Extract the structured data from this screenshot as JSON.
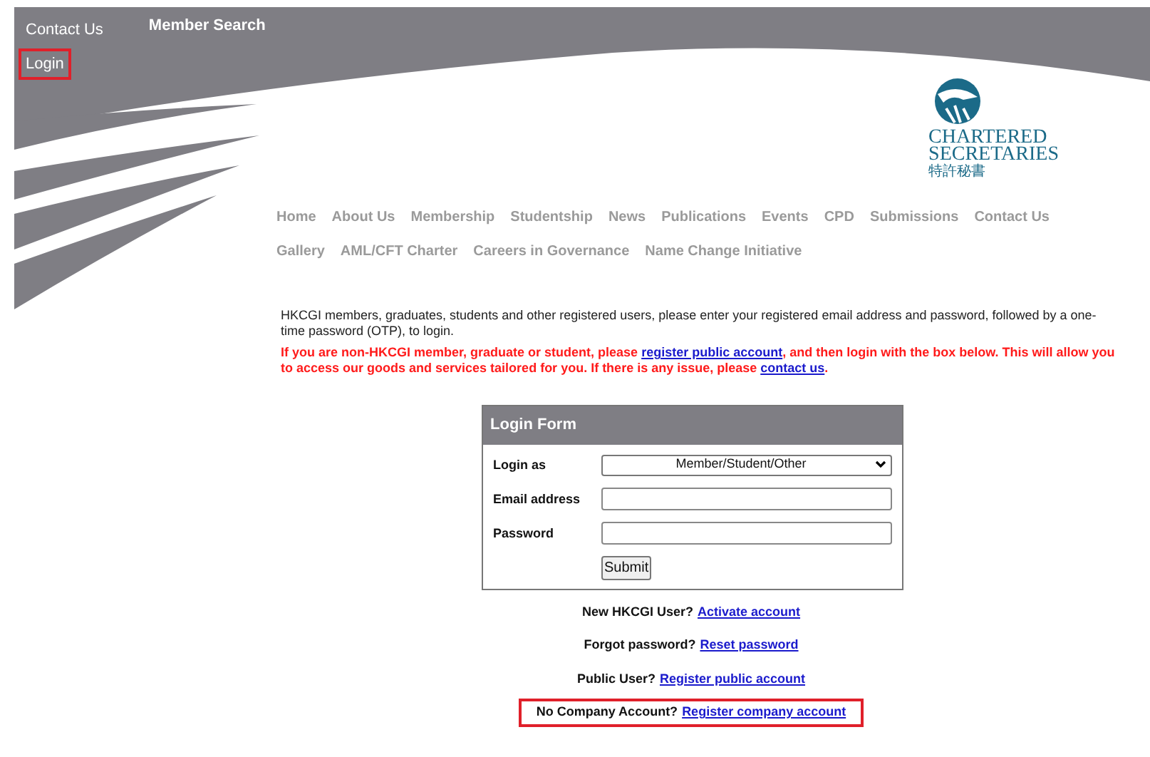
{
  "top_links": [
    {
      "label": "Contact Us",
      "bold": false,
      "highlighted": false
    },
    {
      "label": "Member Search",
      "bold": true,
      "highlighted": false
    },
    {
      "label": "Login",
      "bold": false,
      "highlighted": true
    }
  ],
  "logo": {
    "line_1": "CHARTERED",
    "line_2": "SECRETARIES",
    "line_3": "特許秘書"
  },
  "nav": [
    [
      "Home",
      "About Us",
      "Membership",
      "Studentship",
      "News",
      "Publications",
      "Events",
      "CPD",
      "Submissions",
      "Contact Us"
    ],
    [
      "Gallery",
      "AML/CFT Charter",
      "Careers in Governance",
      "Name Change Initiative"
    ]
  ],
  "intro": "HKCGI members, graduates, students and other registered users, please enter your registered email address and password, followed by a one-time password (OTP), to login.",
  "notice": {
    "before": "If you are non-HKCGI member, graduate or student, please ",
    "link_1": "register public account",
    "middle": ", and then login with the box below. This will allow you to access our goods and services tailored for you. If there is any issue, please ",
    "link_2": "contact us",
    "after": "."
  },
  "login_form": {
    "title": "Login Form",
    "fields": [
      {
        "kind": "select",
        "label": "Login as",
        "value": "Member/Student/Other"
      },
      {
        "kind": "text",
        "label": "Email address"
      },
      {
        "kind": "password",
        "label": "Password"
      }
    ],
    "submit": "Submit"
  },
  "help_links": [
    {
      "prompt": "New HKCGI User?",
      "link": "Activate account",
      "highlighted": false
    },
    {
      "prompt": "Forgot password?",
      "link": "Reset password",
      "highlighted": false
    },
    {
      "prompt": "Public User?",
      "link": "Register public account",
      "highlighted": false
    },
    {
      "prompt": "No Company Account?",
      "link": "Register company account",
      "highlighted": true
    }
  ]
}
